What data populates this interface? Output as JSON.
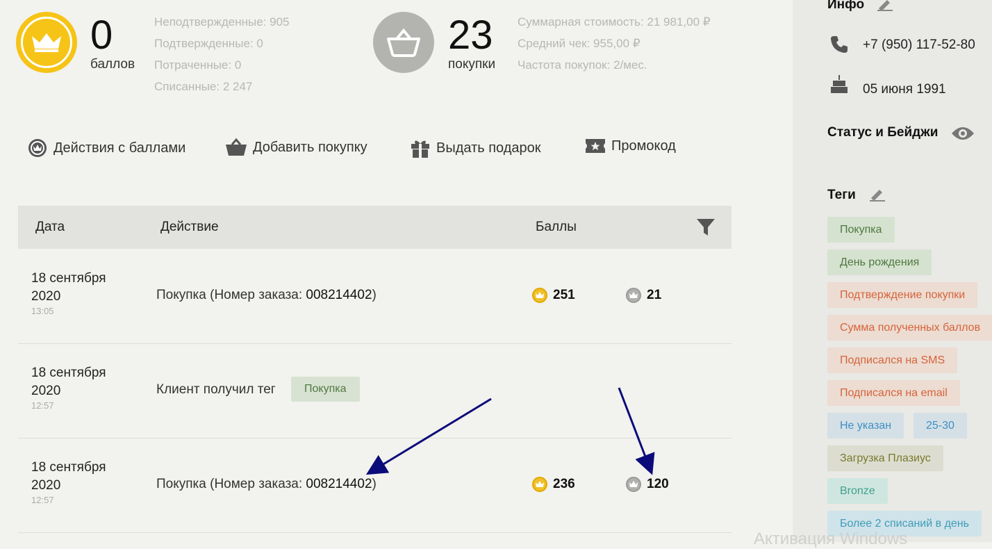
{
  "points": {
    "value": "0",
    "label": "баллов",
    "lines": [
      "Неподтвержденные: 905",
      "Подтвержденные: 0",
      "Потраченные: 0",
      "Списанные: 2 247"
    ]
  },
  "purchases": {
    "value": "23",
    "label": "покупки",
    "lines": [
      "Суммарная стоимость: 21 981,00 ₽",
      "Средний чек: 955,00 ₽",
      "Частота покупок: 2/мес."
    ]
  },
  "actions": {
    "points_actions": "Действия с баллами",
    "add_purchase": "Добавить покупку",
    "give_gift": "Выдать подарок",
    "promo": "Промокод"
  },
  "table": {
    "headers": {
      "date": "Дата",
      "action": "Действие",
      "points": "Баллы"
    },
    "rows": [
      {
        "date": "18 сентября",
        "year": "2020",
        "time": "13:05",
        "action_prefix": "Покупка (Номер заказа: ",
        "order": "008214402",
        "action_suffix": ")",
        "gold": "251",
        "grey": "21"
      },
      {
        "date": "18 сентября",
        "year": "2020",
        "time": "12:57",
        "action_prefix": "Клиент получил тег",
        "tag": "Покупка"
      },
      {
        "date": "18 сентября",
        "year": "2020",
        "time": "12:57",
        "action_prefix": "Покупка (Номер заказа: ",
        "order": "008214402",
        "action_suffix": ")",
        "gold": "236",
        "grey": "120"
      }
    ]
  },
  "sidebar": {
    "info_title": "Инфо",
    "phone": "+7 (950) 117-52-80",
    "birthday": "05 июня 1991",
    "status_title": "Статус и Бейджи",
    "tags_title": "Теги",
    "tags": [
      "Покупка",
      "День рождения",
      "Подтверждение покупки",
      "Сумма полученных баллов",
      "Подписался на SMS",
      "Подписался на email",
      "Не указан",
      "25-30",
      "Загрузка Плазиус",
      "Bronze",
      "Более 2 списаний в день"
    ]
  },
  "watermark": "Активация Windows",
  "colors": {
    "gold": "#f6c417",
    "arrow": "#0b0b7a"
  }
}
